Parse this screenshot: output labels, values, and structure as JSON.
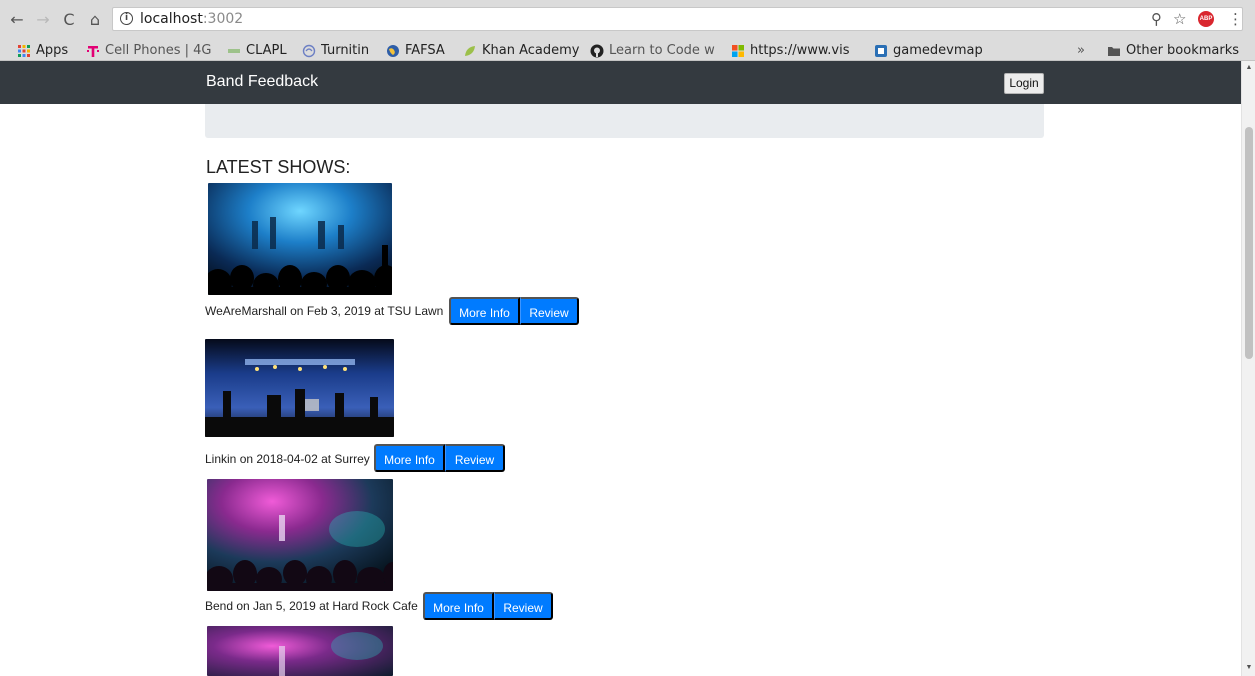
{
  "browser": {
    "url_host": "localhost",
    "url_port": ":3002",
    "bookmarks": [
      {
        "label": "Apps"
      },
      {
        "label": "Cell Phones | 4G"
      },
      {
        "label": "CLAPL"
      },
      {
        "label": "Turnitin"
      },
      {
        "label": "FAFSA"
      },
      {
        "label": "Khan Academy"
      },
      {
        "label": "Learn to Code w"
      },
      {
        "label": "https://www.vis"
      },
      {
        "label": "gamedevmap"
      }
    ],
    "overflow_label": "»",
    "other_bookmarks": "Other bookmarks"
  },
  "navbar": {
    "brand": "Band Feedback",
    "login_label": "Login"
  },
  "main": {
    "section_title": "LATEST SHOWS:",
    "shows": [
      {
        "caption": "WeAreMarshall on Feb 3, 2019 at TSU Lawn",
        "more_info": "More Info",
        "review": "Review"
      },
      {
        "caption": "Linkin on 2018-04-02 at Surrey",
        "more_info": "More Info",
        "review": "Review"
      },
      {
        "caption": "Bend on Jan 5, 2019 at Hard Rock Cafe",
        "more_info": "More Info",
        "review": "Review"
      }
    ]
  },
  "colors": {
    "navbar_bg": "#343a40",
    "button_primary": "#007bff",
    "jumbotron_bg": "#e9ecef"
  },
  "icons": [
    "back-arrow-icon",
    "forward-arrow-icon",
    "reload-icon",
    "home-icon",
    "info-icon",
    "zoom-icon",
    "star-icon",
    "adblock-icon",
    "menu-icon",
    "folder-icon"
  ]
}
